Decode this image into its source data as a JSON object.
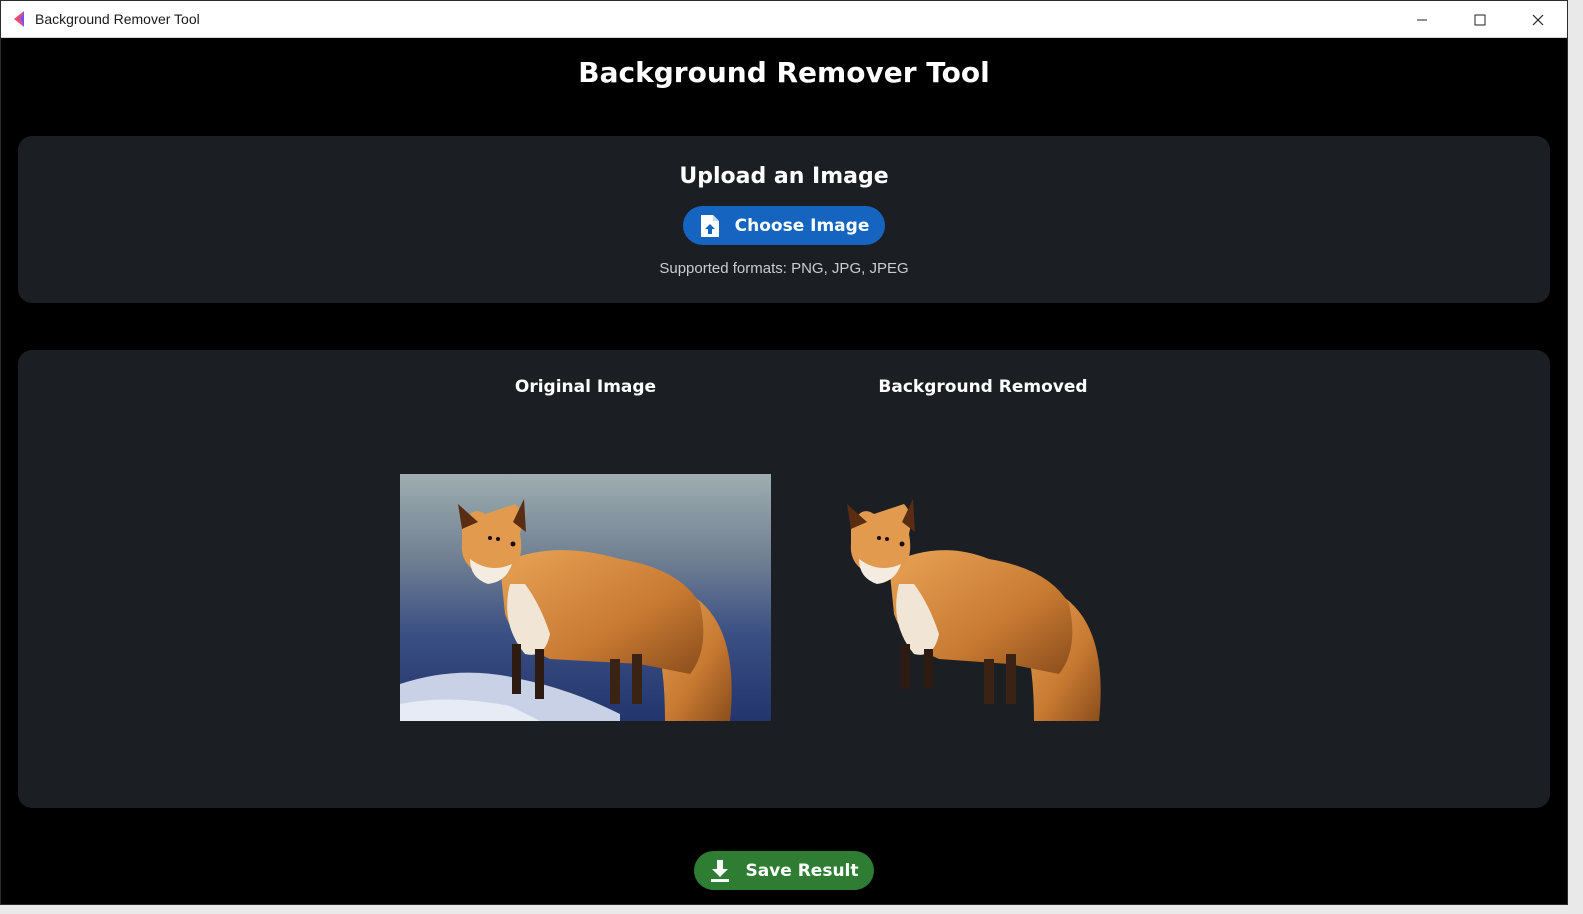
{
  "window": {
    "title": "Background Remover Tool",
    "controls": [
      "minimize",
      "maximize",
      "close"
    ]
  },
  "app": {
    "heading": "Background Remover Tool"
  },
  "upload": {
    "heading": "Upload an Image",
    "button_label": "Choose Image",
    "button_icon": "file-upload-icon",
    "formats_text": "Supported formats: PNG, JPG, JPEG"
  },
  "preview": {
    "original_title": "Original Image",
    "removed_title": "Background Removed"
  },
  "actions": {
    "save_label": "Save Result",
    "save_icon": "download-icon"
  },
  "colors": {
    "background": "#000000",
    "panel": "#1b1e23",
    "choose_button": "#1565c0",
    "save_button": "#2e7d32",
    "text": "#ffffff",
    "muted_text": "#c9ccd1"
  }
}
